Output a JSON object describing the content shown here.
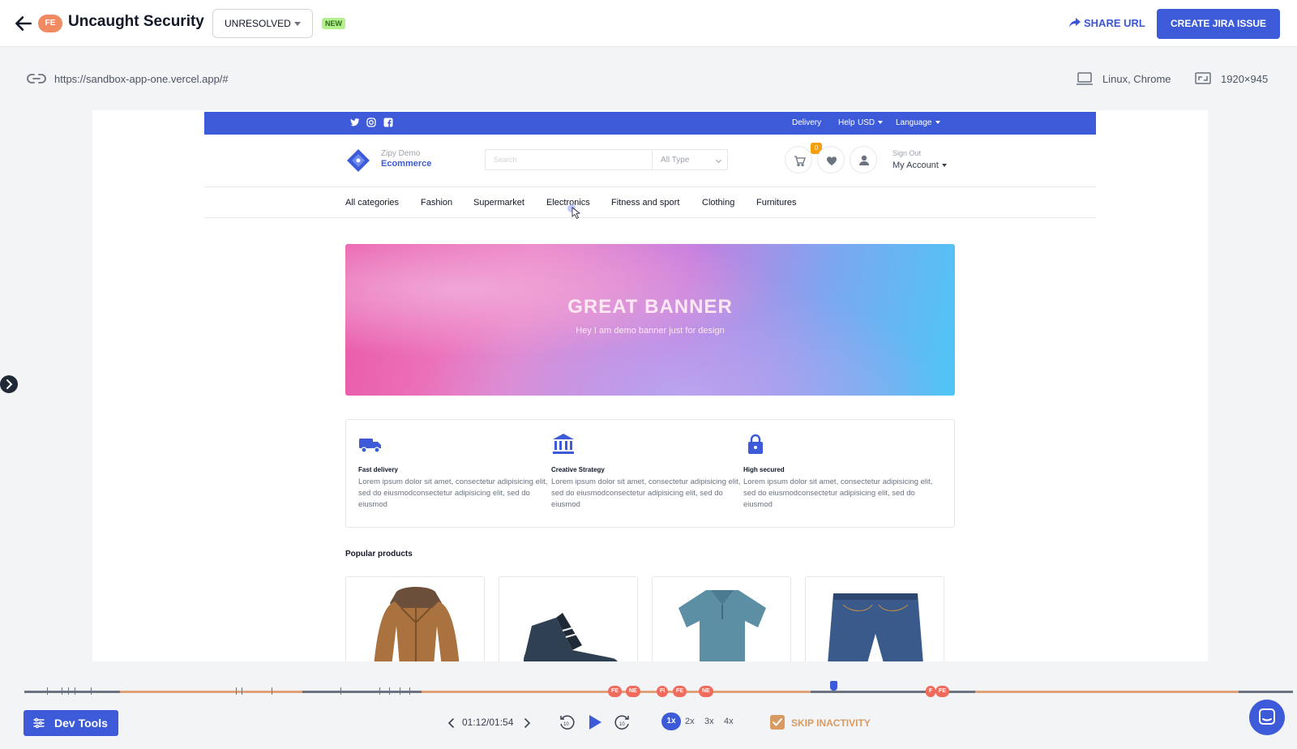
{
  "header": {
    "back_label": "back",
    "badge": "FE",
    "title": "Uncaught Security",
    "status": "UNRESOLVED",
    "new_badge": "NEW",
    "share_label": "SHARE URL",
    "jira_label": "CREATE JIRA ISSUE"
  },
  "session": {
    "url": "https://sandbox-app-one.vercel.app/#",
    "platform": "Linux, Chrome",
    "resolution": "1920×945"
  },
  "site": {
    "top_links": [
      "Delivery",
      "Help",
      "USD",
      "Language"
    ],
    "brand_line1": "Zipy Demo",
    "brand_line2": "Ecommerce",
    "search_placeholder": "Search",
    "type_select": "All Type",
    "cart_count": "0",
    "sign_out": "Sign Out",
    "my_account": "My Account",
    "categories": [
      "All categories",
      "Fashion",
      "Supermarket",
      "Electronics",
      "Fitness and sport",
      "Clothing",
      "Furnitures"
    ],
    "banner_title": "GREAT BANNER",
    "banner_subtitle": "Hey I am demo banner just for design",
    "features": [
      {
        "title": "Fast delivery",
        "desc": "Lorem ipsum dolor sit amet, consectetur adipisicing elit, sed do eiusmodconsectetur adipisicing elit, sed do eiusmod"
      },
      {
        "title": "Creative Strategy",
        "desc": "Lorem ipsum dolor sit amet, consectetur adipisicing elit, sed do eiusmodconsectetur adipisicing elit, sed do eiusmod"
      },
      {
        "title": "High secured",
        "desc": "Lorem ipsum dolor sit amet, consectetur adipisicing elit, sed do eiusmodconsectetur adipisicing elit, sed do eiusmod"
      }
    ],
    "popular_title": "Popular products"
  },
  "timeline": {
    "events": [
      "FE",
      "NE",
      "FI",
      "FE",
      "NE",
      "F",
      "FE"
    ]
  },
  "controls": {
    "dev_tools": "Dev Tools",
    "time": "01:12/01:54",
    "speeds": [
      "1x",
      "2x",
      "3x",
      "4x"
    ],
    "skip_inactivity": "SKIP INACTIVITY"
  },
  "colors": {
    "accent": "#3d5bd9",
    "badge": "#ef8a62",
    "skip": "#d99a62"
  }
}
